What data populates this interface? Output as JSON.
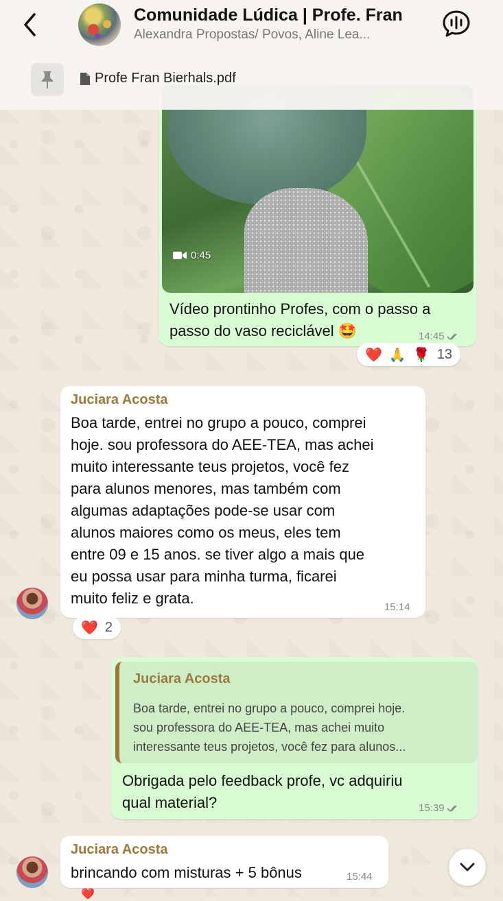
{
  "header": {
    "title": "Comunidade Lúdica | Profe. Fran",
    "subtitle": "Alexandra Propostas/ Povos, Aline Lea...",
    "back_icon": "chevron-left-icon",
    "call_icon": "audio-call-icon"
  },
  "pinned": {
    "icon": "pin-icon",
    "file_icon": "document-icon",
    "file_name": "Profe Fran Bierhals.pdf"
  },
  "messages": [
    {
      "type": "video",
      "direction": "outgoing",
      "duration": "0:45",
      "caption_line1": "Vídeo prontinho Profes, com o passo a",
      "caption_line2": "passo do vaso reciclável 🤩",
      "time": "14:45",
      "reactions": [
        "❤️",
        "🙏",
        "🌹"
      ],
      "reaction_count": "13"
    },
    {
      "type": "text",
      "direction": "incoming",
      "sender": "Juciara Acosta",
      "lines": [
        "Boa tarde, entrei  no grupo a pouco, comprei",
        "hoje. sou professora do AEE-TEA, mas achei",
        "muito interessante teus projetos, você fez",
        "para alunos menores, mas também com",
        "algumas adaptações pode-se usar com",
        "alunos maiores como os meus, eles tem",
        "entre 09 e 15 anos. se tiver algo a mais que",
        "eu possa usar para minha turma, ficarei",
        "muito feliz e grata."
      ],
      "time": "15:14",
      "reactions": [
        "❤️"
      ],
      "reaction_count": "2"
    },
    {
      "type": "reply",
      "direction": "outgoing",
      "quote_sender": "Juciara Acosta",
      "quote_lines": [
        "Boa tarde, entrei  no grupo a pouco, comprei hoje.",
        "sou professora do AEE-TEA, mas achei muito",
        "interessante teus projetos, você fez para alunos..."
      ],
      "line1": "Obrigada pelo feedback profe, vc adquiriu",
      "line2": "qual material?",
      "time": "15:39"
    },
    {
      "type": "text",
      "direction": "incoming",
      "sender": "Juciara Acosta",
      "text": "brincando com misturas + 5 bônus",
      "time": "15:44"
    }
  ],
  "scroll_down_icon": "chevron-down-icon",
  "colors": {
    "outgoing_bubble": "#d9fdd3",
    "incoming_bubble": "#ffffff",
    "sender_name": "#9c7a3c",
    "wallpaper": "#efe8dc"
  }
}
